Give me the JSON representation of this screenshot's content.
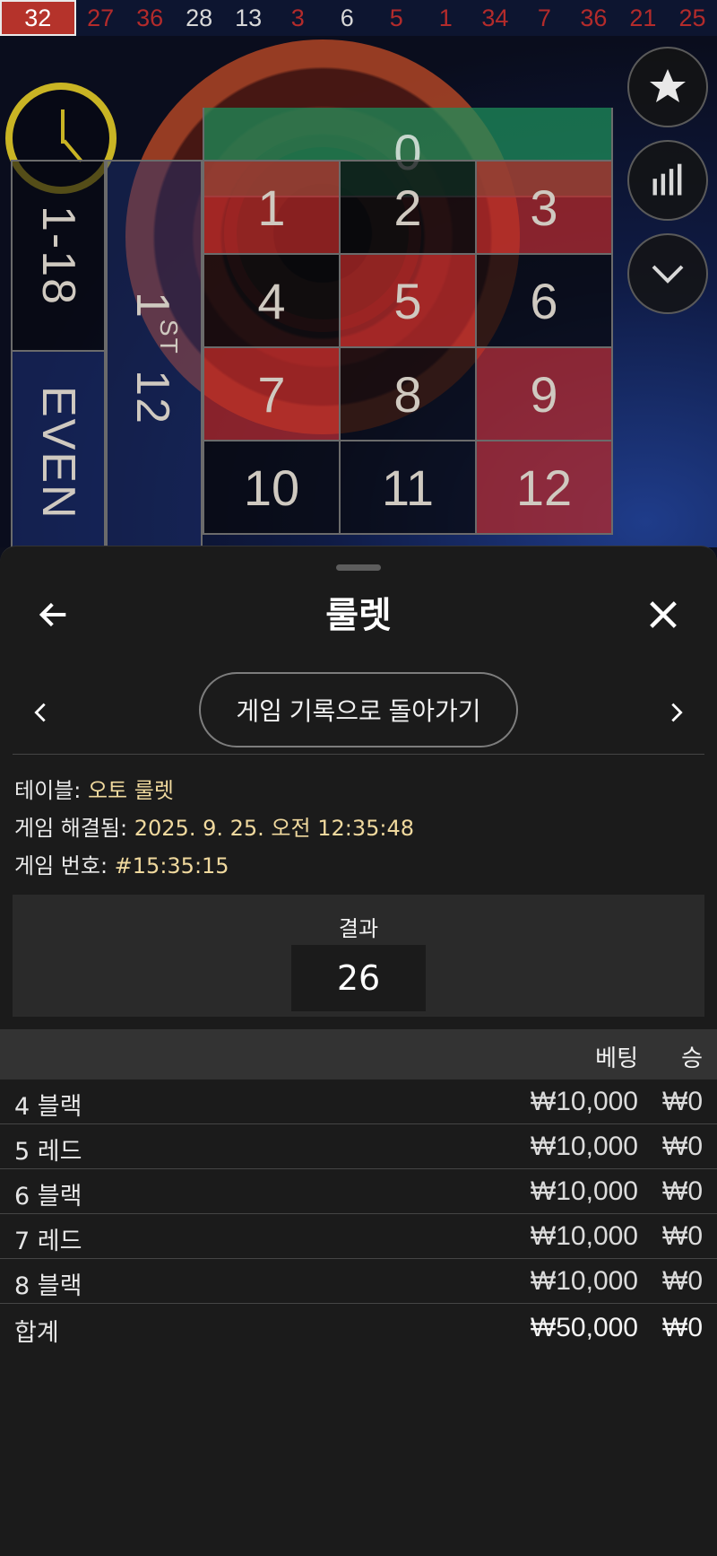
{
  "history": [
    {
      "n": "32",
      "color": "red"
    },
    {
      "n": "27",
      "color": "red"
    },
    {
      "n": "36",
      "color": "red"
    },
    {
      "n": "28",
      "color": "black"
    },
    {
      "n": "13",
      "color": "black"
    },
    {
      "n": "3",
      "color": "red"
    },
    {
      "n": "6",
      "color": "black"
    },
    {
      "n": "5",
      "color": "red"
    },
    {
      "n": "1",
      "color": "red"
    },
    {
      "n": "34",
      "color": "red"
    },
    {
      "n": "7",
      "color": "red"
    },
    {
      "n": "36",
      "color": "red"
    },
    {
      "n": "21",
      "color": "red"
    },
    {
      "n": "25",
      "color": "red"
    }
  ],
  "table": {
    "zero": "0",
    "low": "1-18",
    "even": "EVEN",
    "dozen_main": "1",
    "dozen_sup": "ST",
    "dozen_num": "12",
    "numbers": [
      "1",
      "2",
      "3",
      "4",
      "5",
      "6",
      "7",
      "8",
      "9",
      "10",
      "11",
      "12"
    ]
  },
  "icons": {
    "timer": "clock-icon",
    "favorite": "star-icon",
    "stats": "bar-chart-icon",
    "collapse": "chevron-down-icon"
  },
  "sheet": {
    "title": "룰렛",
    "back_to_history": "게임 기록으로 돌아가기",
    "table_label": "테이블: ",
    "table_value": "오토 룰렛",
    "resolved_label": "게임 해결됨: ",
    "resolved_value": "2025. 9. 25. 오전 12:35:48",
    "game_no_label": "게임 번호: ",
    "game_no_value": "#15:35:15",
    "result_label": "결과",
    "result_value": "26",
    "col_bet": "베팅",
    "col_win": "승",
    "bets": [
      {
        "name": "4 블랙",
        "amount": "₩10,000",
        "win": "₩0"
      },
      {
        "name": "5 레드",
        "amount": "₩10,000",
        "win": "₩0"
      },
      {
        "name": "6 블랙",
        "amount": "₩10,000",
        "win": "₩0"
      },
      {
        "name": "7 레드",
        "amount": "₩10,000",
        "win": "₩0"
      },
      {
        "name": "8 블랙",
        "amount": "₩10,000",
        "win": "₩0"
      }
    ],
    "total_label": "합계",
    "total_amount": "₩50,000",
    "total_win": "₩0"
  },
  "colors": {
    "red": "#b32b2b",
    "accent_value": "#f0d99e",
    "timer": "#c9b424"
  }
}
